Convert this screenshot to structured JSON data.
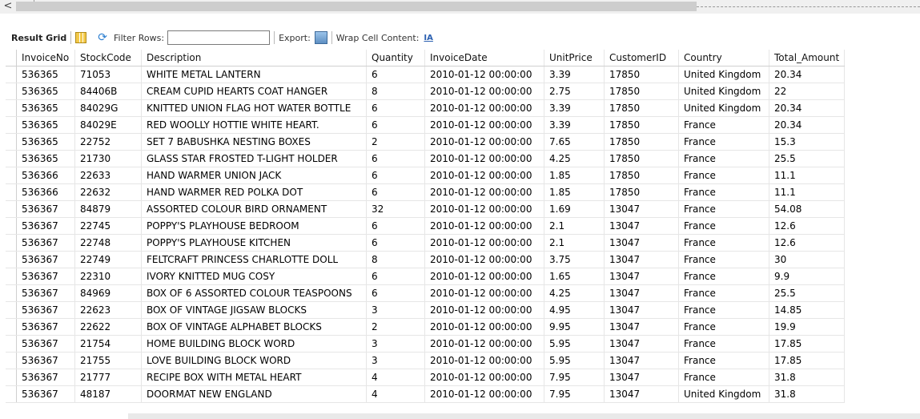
{
  "scrollbar": {
    "left_arrow": "<"
  },
  "toolbar": {
    "result_grid_label": "Result Grid",
    "filter_rows_label": "Filter Rows:",
    "filter_rows_value": "",
    "export_label": "Export:",
    "wrap_label": "Wrap Cell Content:",
    "wrap_icon_text": "IA"
  },
  "grid": {
    "columns": [
      "InvoiceNo",
      "StockCode",
      "Description",
      "Quantity",
      "InvoiceDate",
      "UnitPrice",
      "CustomerID",
      "Country",
      "Total_Amount"
    ],
    "rows": [
      [
        "536365",
        "71053",
        "WHITE METAL LANTERN",
        "6",
        "2010-01-12 00:00:00",
        "3.39",
        "17850",
        "United Kingdom",
        "20.34"
      ],
      [
        "536365",
        "84406B",
        "CREAM CUPID HEARTS COAT HANGER",
        "8",
        "2010-01-12 00:00:00",
        "2.75",
        "17850",
        "United Kingdom",
        "22"
      ],
      [
        "536365",
        "84029G",
        "KNITTED UNION FLAG HOT WATER BOTTLE",
        "6",
        "2010-01-12 00:00:00",
        "3.39",
        "17850",
        "United Kingdom",
        "20.34"
      ],
      [
        "536365",
        "84029E",
        "RED WOOLLY HOTTIE WHITE HEART.",
        "6",
        "2010-01-12 00:00:00",
        "3.39",
        "17850",
        "France",
        "20.34"
      ],
      [
        "536365",
        "22752",
        "SET 7 BABUSHKA NESTING BOXES",
        "2",
        "2010-01-12 00:00:00",
        "7.65",
        "17850",
        "France",
        "15.3"
      ],
      [
        "536365",
        "21730",
        "GLASS STAR FROSTED T-LIGHT HOLDER",
        "6",
        "2010-01-12 00:00:00",
        "4.25",
        "17850",
        "France",
        "25.5"
      ],
      [
        "536366",
        "22633",
        "HAND WARMER UNION JACK",
        "6",
        "2010-01-12 00:00:00",
        "1.85",
        "17850",
        "France",
        "11.1"
      ],
      [
        "536366",
        "22632",
        "HAND WARMER RED POLKA DOT",
        "6",
        "2010-01-12 00:00:00",
        "1.85",
        "17850",
        "France",
        "11.1"
      ],
      [
        "536367",
        "84879",
        "ASSORTED COLOUR BIRD ORNAMENT",
        "32",
        "2010-01-12 00:00:00",
        "1.69",
        "13047",
        "France",
        "54.08"
      ],
      [
        "536367",
        "22745",
        "POPPY'S PLAYHOUSE BEDROOM",
        "6",
        "2010-01-12 00:00:00",
        "2.1",
        "13047",
        "France",
        "12.6"
      ],
      [
        "536367",
        "22748",
        "POPPY'S PLAYHOUSE KITCHEN",
        "6",
        "2010-01-12 00:00:00",
        "2.1",
        "13047",
        "France",
        "12.6"
      ],
      [
        "536367",
        "22749",
        "FELTCRAFT PRINCESS CHARLOTTE DOLL",
        "8",
        "2010-01-12 00:00:00",
        "3.75",
        "13047",
        "France",
        "30"
      ],
      [
        "536367",
        "22310",
        "IVORY KNITTED MUG COSY",
        "6",
        "2010-01-12 00:00:00",
        "1.65",
        "13047",
        "France",
        "9.9"
      ],
      [
        "536367",
        "84969",
        "BOX OF 6 ASSORTED COLOUR TEASPOONS",
        "6",
        "2010-01-12 00:00:00",
        "4.25",
        "13047",
        "France",
        "25.5"
      ],
      [
        "536367",
        "22623",
        "BOX OF VINTAGE JIGSAW BLOCKS",
        "3",
        "2010-01-12 00:00:00",
        "4.95",
        "13047",
        "France",
        "14.85"
      ],
      [
        "536367",
        "22622",
        "BOX OF VINTAGE ALPHABET BLOCKS",
        "2",
        "2010-01-12 00:00:00",
        "9.95",
        "13047",
        "France",
        "19.9"
      ],
      [
        "536367",
        "21754",
        "HOME BUILDING BLOCK WORD",
        "3",
        "2010-01-12 00:00:00",
        "5.95",
        "13047",
        "France",
        "17.85"
      ],
      [
        "536367",
        "21755",
        "LOVE BUILDING BLOCK WORD",
        "3",
        "2010-01-12 00:00:00",
        "5.95",
        "13047",
        "France",
        "17.85"
      ],
      [
        "536367",
        "21777",
        "RECIPE BOX WITH METAL HEART",
        "4",
        "2010-01-12 00:00:00",
        "7.95",
        "13047",
        "France",
        "31.8"
      ],
      [
        "536367",
        "48187",
        "DOORMAT NEW ENGLAND",
        "4",
        "2010-01-12 00:00:00",
        "7.95",
        "13047",
        "United Kingdom",
        "31.8"
      ]
    ]
  }
}
